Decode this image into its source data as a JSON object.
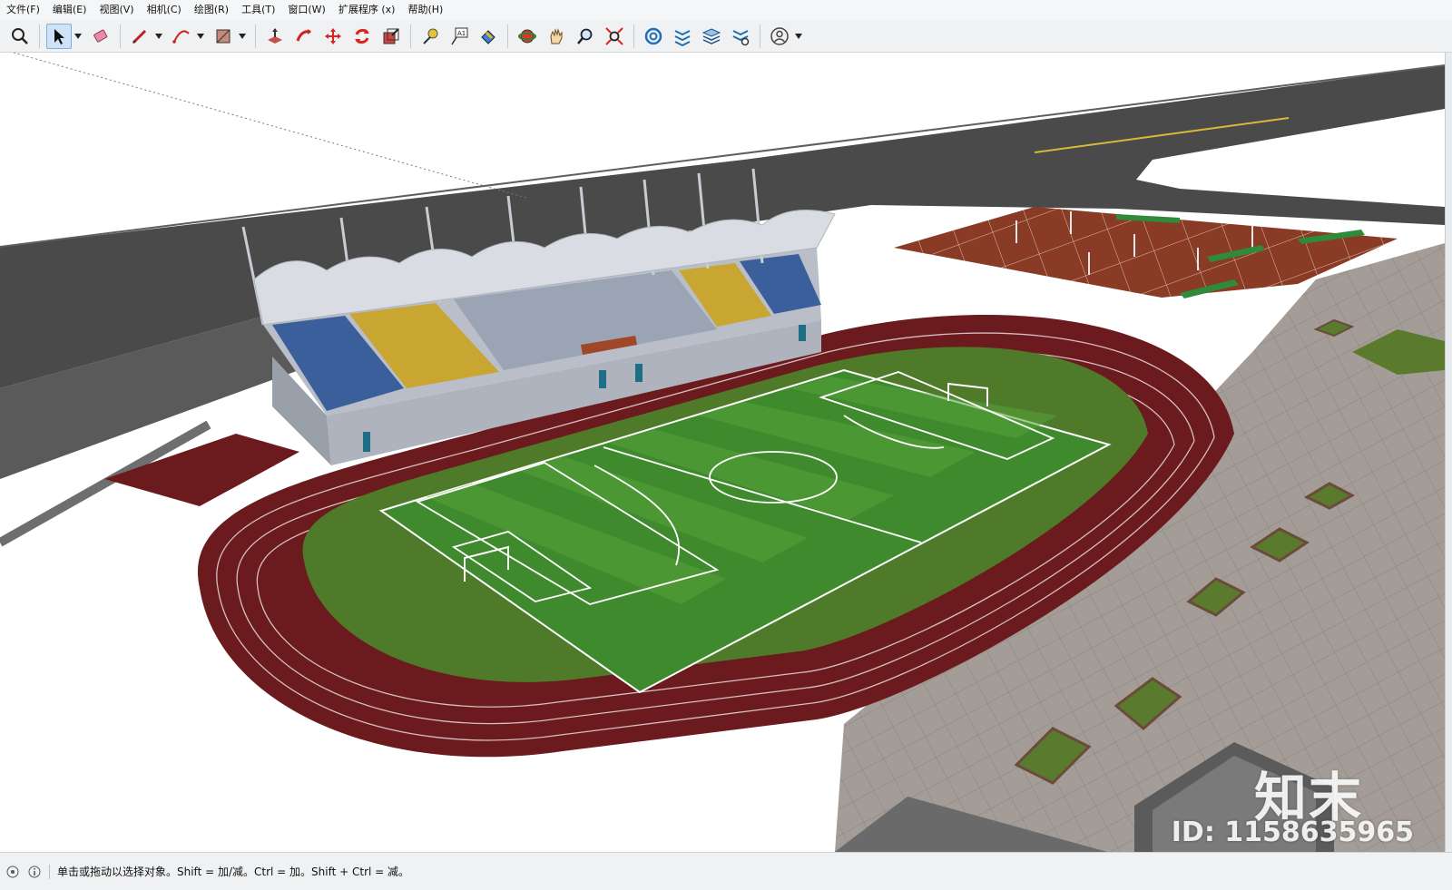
{
  "menu": {
    "items": [
      "文件(F)",
      "编辑(E)",
      "视图(V)",
      "相机(C)",
      "绘图(R)",
      "工具(T)",
      "窗口(W)",
      "扩展程序 (x)",
      "帮助(H)"
    ]
  },
  "toolbar": {
    "tools": [
      {
        "name": "zoom-window-icon"
      },
      {
        "name": "select-icon",
        "active": true
      },
      {
        "name": "eraser-icon"
      },
      {
        "name": "pencil-line-icon"
      },
      {
        "name": "arc-icon"
      },
      {
        "name": "rectangle-icon"
      },
      {
        "name": "push-pull-icon"
      },
      {
        "name": "follow-me-icon"
      },
      {
        "name": "move-icon"
      },
      {
        "name": "rotate-icon"
      },
      {
        "name": "scale-icon"
      },
      {
        "name": "tape-measure-icon"
      },
      {
        "name": "text-icon",
        "label": "A1"
      },
      {
        "name": "paint-bucket-icon"
      },
      {
        "name": "orbit-icon"
      },
      {
        "name": "pan-icon"
      },
      {
        "name": "zoom-icon"
      },
      {
        "name": "zoom-extents-icon"
      },
      {
        "name": "warehouse-icon"
      },
      {
        "name": "extension-warehouse-icon"
      },
      {
        "name": "layers-icon"
      },
      {
        "name": "extension-manager-icon"
      },
      {
        "name": "account-icon"
      }
    ]
  },
  "status": {
    "message": "单击或拖动以选择对象。Shift = 加/减。Ctrl = 加。Shift + Ctrl = 减。"
  },
  "watermark": {
    "logo": "知末",
    "id": "ID: 1158635965"
  },
  "colors": {
    "track": "#6b1a1e",
    "field_green": "#3e8a2c",
    "field_green_light": "#57a33b",
    "grass_outer": "#4f7a2a",
    "road": "#4a4a4a",
    "plaza": "#a09a95",
    "seat_blue": "#3a5f9a",
    "seat_yellow": "#c9a632",
    "court": "#8a3b25"
  }
}
